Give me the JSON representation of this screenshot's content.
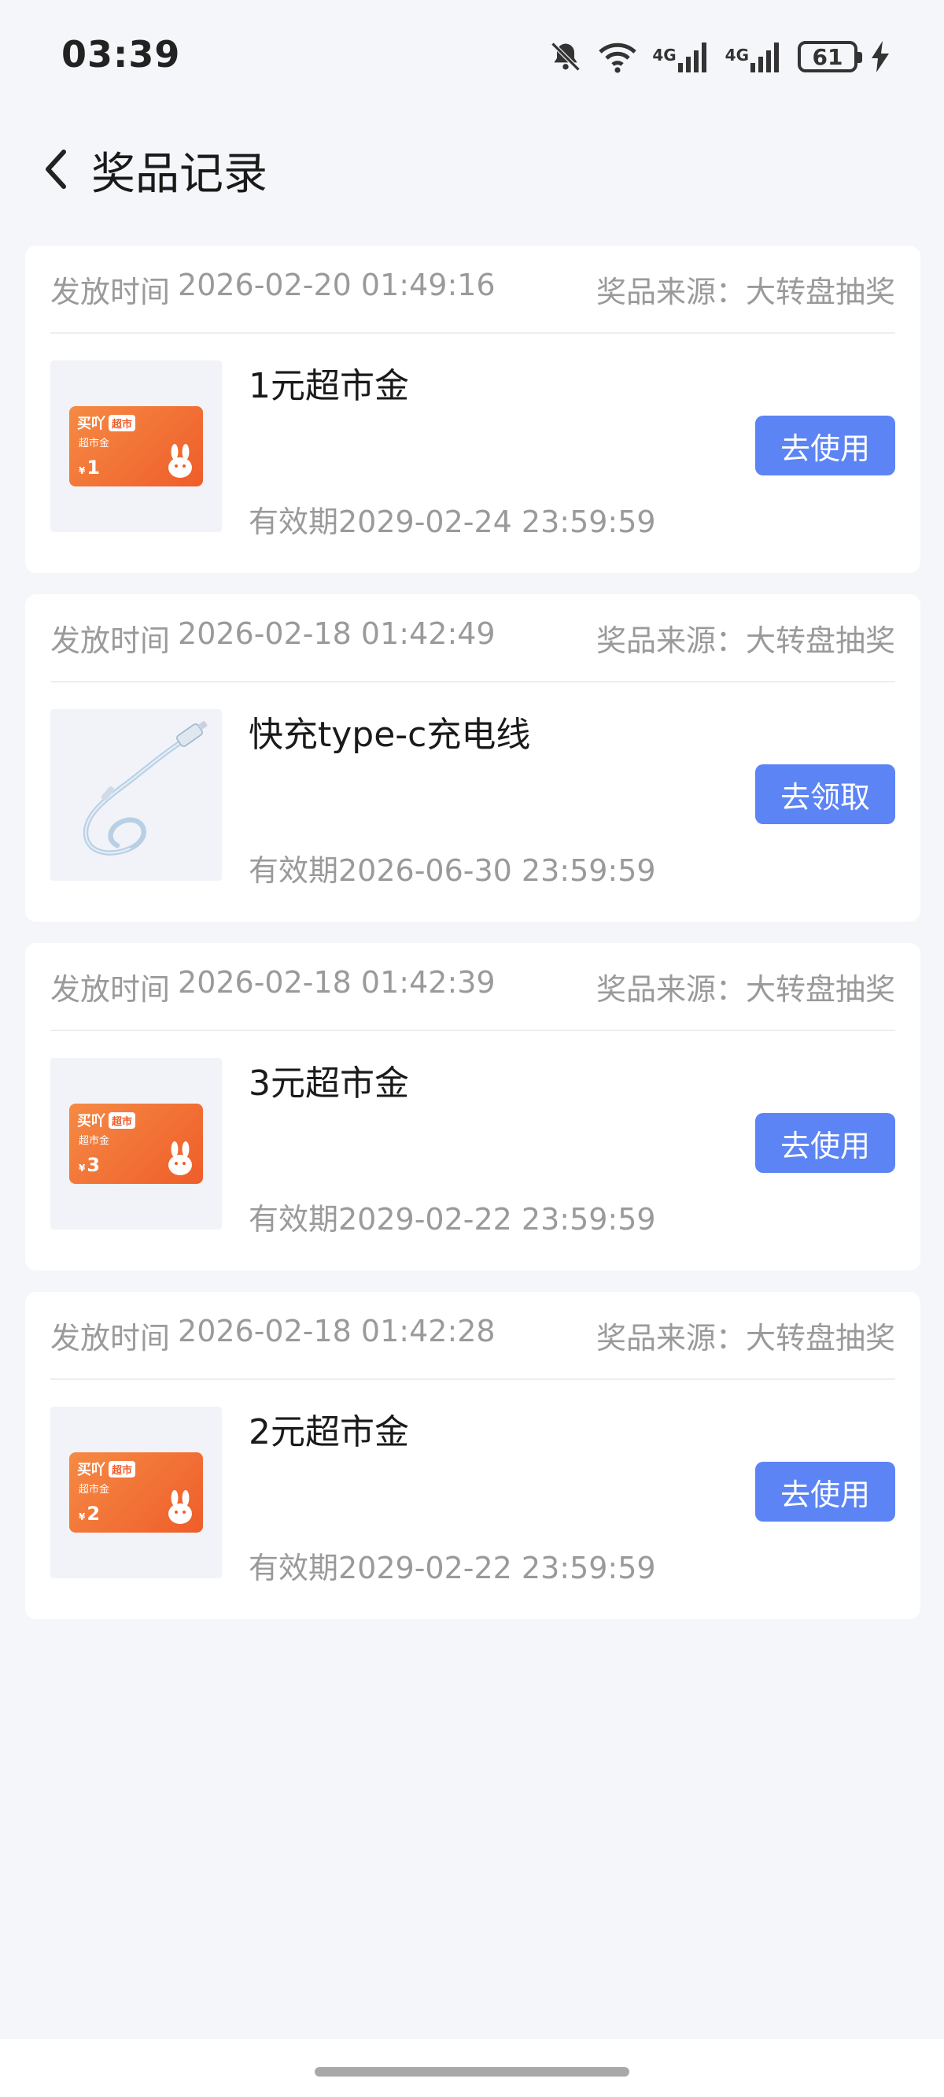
{
  "status_bar": {
    "time": "03:39",
    "network_1": "4G",
    "network_2": "4G",
    "battery": "61",
    "icons": [
      "bell-muted-icon",
      "wifi-icon",
      "signal-icon",
      "signal-icon",
      "battery-icon",
      "charging-icon"
    ]
  },
  "header": {
    "title": "奖品记录",
    "back_icon": "chevron-left-icon"
  },
  "records": [
    {
      "issue_label": "发放时间",
      "issue_time": "2026-02-20 01:49:16",
      "source": "奖品来源：大转盘抽奖",
      "name": "1元超市金",
      "validity": "有效期2029-02-24 23:59:59",
      "action": "去使用",
      "thumb": "coupon",
      "coupon": {
        "brand": "买吖",
        "tag": "超市",
        "sub": "超市金",
        "currency": "¥",
        "amount": "1"
      }
    },
    {
      "issue_label": "发放时间",
      "issue_time": "2026-02-18 01:42:49",
      "source": "奖品来源：大转盘抽奖",
      "name": "快充type-c充电线",
      "validity": "有效期2026-06-30 23:59:59",
      "action": "去领取",
      "thumb": "cable"
    },
    {
      "issue_label": "发放时间",
      "issue_time": "2026-02-18 01:42:39",
      "source": "奖品来源：大转盘抽奖",
      "name": "3元超市金",
      "validity": "有效期2029-02-22 23:59:59",
      "action": "去使用",
      "thumb": "coupon",
      "coupon": {
        "brand": "买吖",
        "tag": "超市",
        "sub": "超市金",
        "currency": "¥",
        "amount": "3"
      }
    },
    {
      "issue_label": "发放时间",
      "issue_time": "2026-02-18 01:42:28",
      "source": "奖品来源：大转盘抽奖",
      "name": "2元超市金",
      "validity": "有效期2029-02-22 23:59:59",
      "action": "去使用",
      "thumb": "coupon",
      "coupon": {
        "brand": "买吖",
        "tag": "超市",
        "sub": "超市金",
        "currency": "¥",
        "amount": "2"
      }
    }
  ],
  "colors": {
    "background": "#f5f6fa",
    "button": "#5c84f5",
    "coupon": "#ef5d2a",
    "muted_text": "#9a9a9a"
  }
}
